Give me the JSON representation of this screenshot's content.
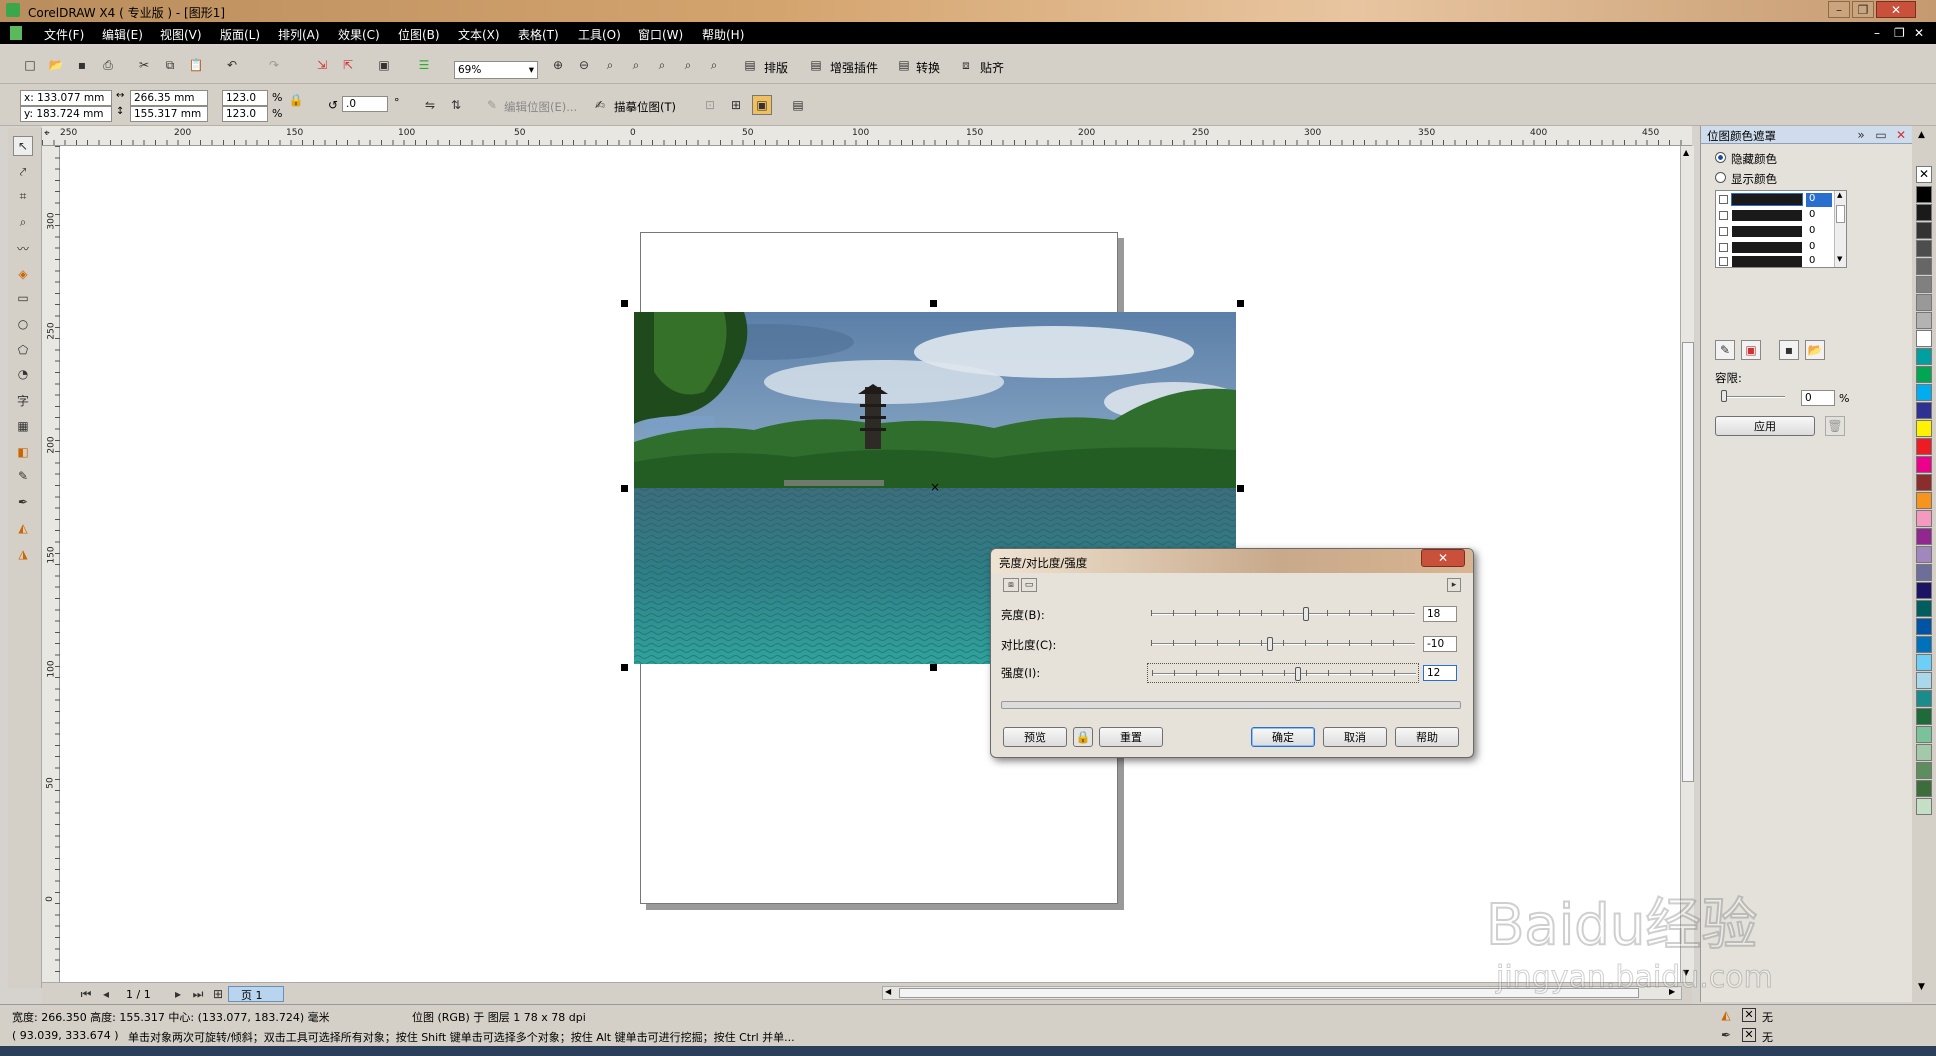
{
  "window": {
    "title": "CorelDRAW X4 ( 专业版 ) - [图形1]"
  },
  "menu": [
    "文件(F)",
    "编辑(E)",
    "视图(V)",
    "版面(L)",
    "排列(A)",
    "效果(C)",
    "位图(B)",
    "文本(X)",
    "表格(T)",
    "工具(O)",
    "窗口(W)",
    "帮助(H)"
  ],
  "toolbar": {
    "zoom": "69%",
    "plugins": [
      "排版",
      "增强插件",
      "转换",
      "贴齐"
    ]
  },
  "property_bar": {
    "x": "x: 133.077 mm",
    "y": "y: 183.724 mm",
    "width": "266.35 mm",
    "height": "155.317 mm",
    "scale_x": "123.0",
    "scale_y": "123.0",
    "percent": "%",
    "rotation": ".0",
    "degree": "°",
    "edit_bitmap": "编辑位图(E)...",
    "trace_bitmap": "描摹位图(T)"
  },
  "ruler_h": [
    "250",
    "200",
    "150",
    "100",
    "50",
    "0",
    "50",
    "100",
    "150",
    "200",
    "250",
    "300",
    "350",
    "400",
    "450"
  ],
  "ruler_v": [
    "300",
    "250",
    "200",
    "150",
    "100",
    "50",
    "0"
  ],
  "docker": {
    "title": "位图颜色遮罩",
    "hide_color": "隐藏颜色",
    "show_color": "显示颜色",
    "color_rows": [
      "0",
      "0",
      "0",
      "0",
      "0"
    ],
    "tolerance_label": "容限:",
    "tolerance_value": "0",
    "tolerance_unit": "%",
    "apply_button": "应用"
  },
  "dialog": {
    "title": "亮度/对比度/强度",
    "brightness_label": "亮度(B):",
    "brightness_value": "18",
    "contrast_label": "对比度(C):",
    "contrast_value": "-10",
    "intensity_label": "强度(I):",
    "intensity_value": "12",
    "preview_button": "预览",
    "reset_button": "重置",
    "ok_button": "确定",
    "cancel_button": "取消",
    "help_button": "帮助",
    "brightness_pos": 0.59,
    "contrast_pos": 0.45,
    "intensity_pos": 0.56
  },
  "pages": {
    "counter": "1 / 1",
    "page_tab": "页 1"
  },
  "status": {
    "line1": "宽度: 266.350  高度: 155.317  中心: (133.077, 183.724)  毫米",
    "object_info": "位图 (RGB) 于 图层 1 78 x 78 dpi",
    "line2": "( 93.039, 333.674 )",
    "hint": "单击对象两次可旋转/倾斜；双击工具可选择所有对象；按住 Shift 键单击可选择多个对象；按住 Alt 键单击可进行挖掘；按住 Ctrl 并单...",
    "fill": "无",
    "outline": "无"
  },
  "watermark": {
    "brand": "Baidu经验",
    "url": "jingyan.baidu.com"
  }
}
